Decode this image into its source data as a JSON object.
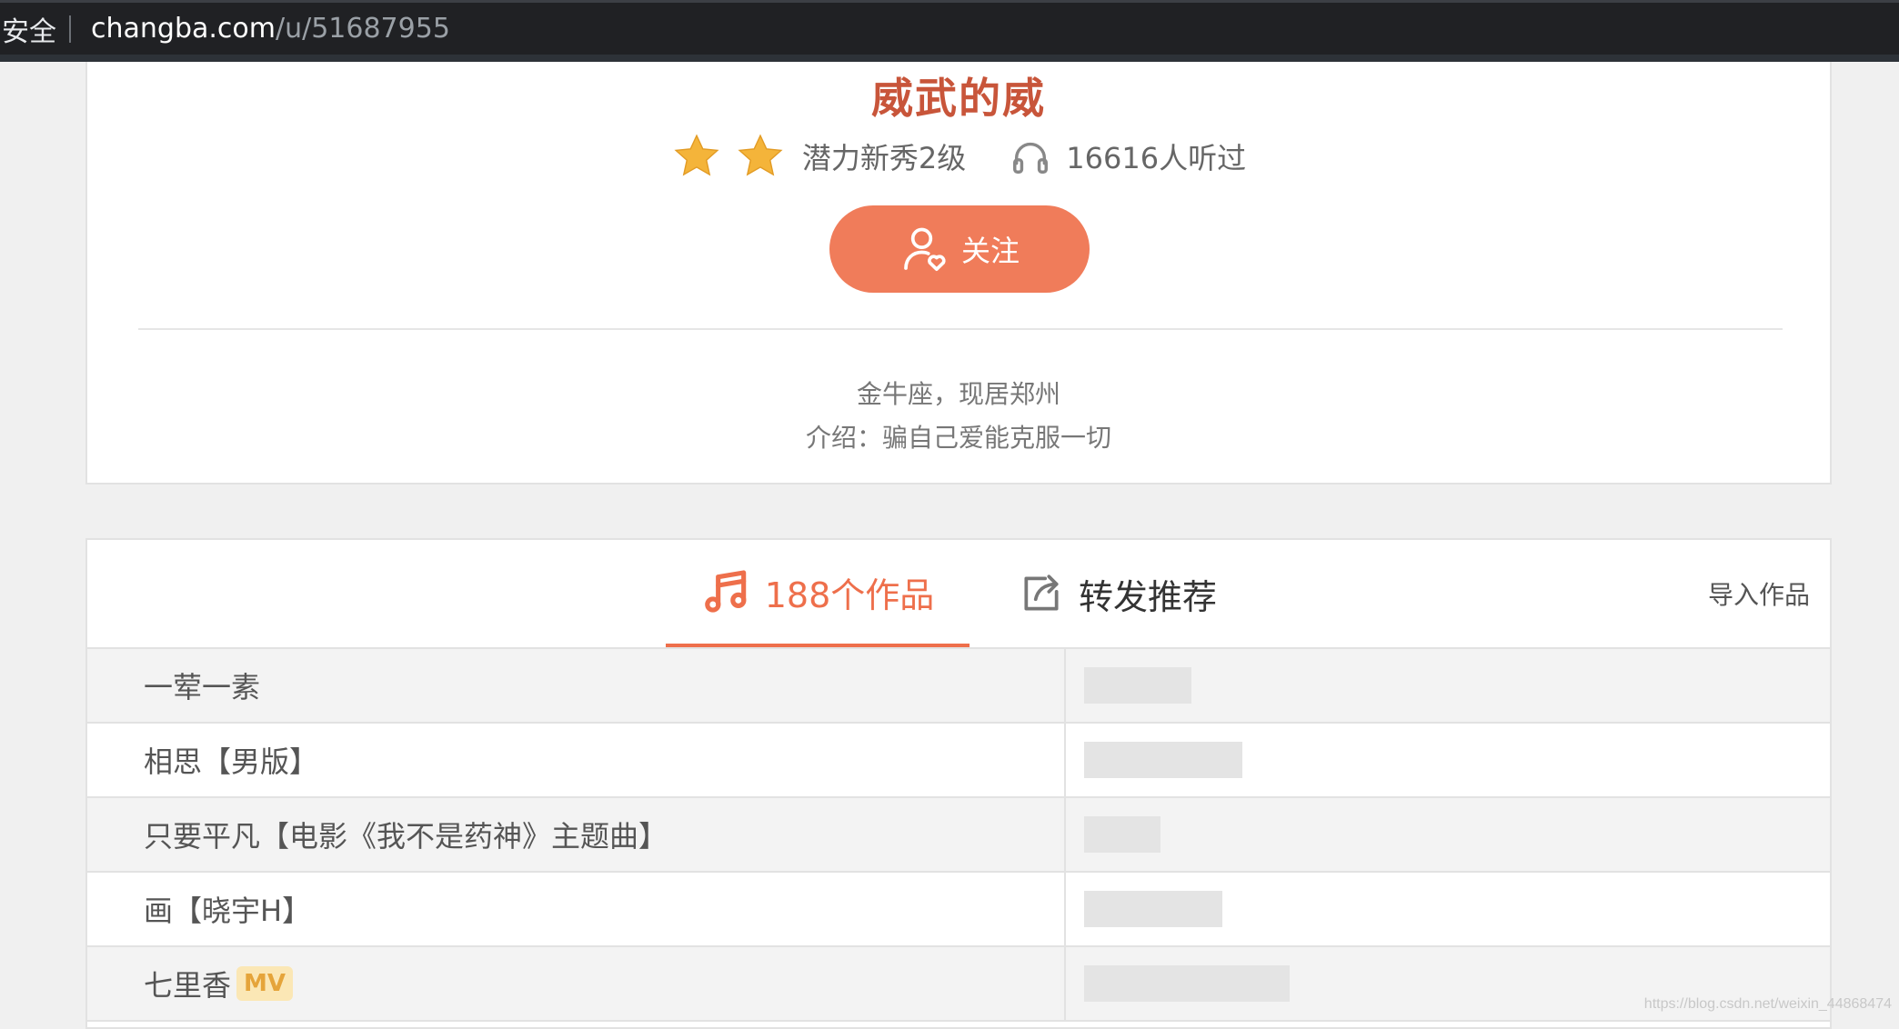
{
  "browser": {
    "security_label": "安全",
    "url_host": "changba.com",
    "url_path": "/u/51687955"
  },
  "profile": {
    "name": "威武的威",
    "level": "潜力新秀2级",
    "stars": 2,
    "listen_count": "16616人听过",
    "follow_label": "关注",
    "info_line1": "金牛座，现居郑州",
    "info_line2": "介绍：骗自己爱能克服一切"
  },
  "tabs": {
    "works_label": "188个作品",
    "recommend_label": "转发推荐",
    "import_label": "导入作品"
  },
  "songs": [
    {
      "title": "一荤一素",
      "mv": false
    },
    {
      "title": "相思【男版】",
      "mv": false
    },
    {
      "title": "只要平凡【电影《我不是药神》主题曲】",
      "mv": false
    },
    {
      "title": "画【晓宇H】",
      "mv": false
    },
    {
      "title": "七里香",
      "mv": true,
      "badge": "MV"
    }
  ],
  "watermark": "https://blog.csdn.net/weixin_44868474",
  "colors": {
    "accent": "#f07c5a",
    "name": "#c8553a",
    "mv_badge": "#e5a43a"
  }
}
